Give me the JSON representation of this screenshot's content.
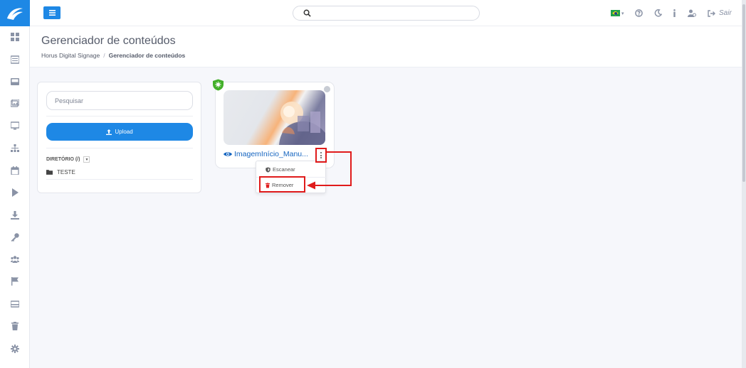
{
  "topbar": {
    "search_placeholder": "",
    "logout_label": "Sair",
    "language_flag": "brazil-flag"
  },
  "header": {
    "title": "Gerenciador de conteúdos",
    "breadcrumb": [
      "Horus Digital Signage",
      "Gerenciador de conteúdos"
    ]
  },
  "left_panel": {
    "search_placeholder": "Pesquisar",
    "upload_label": "Upload",
    "directory_label": "DIRETÓRIO (/)",
    "folders": [
      "TESTE"
    ]
  },
  "content": {
    "items": [
      {
        "title": "ImagemInício_Manu...",
        "status_color": "#c8ccd4"
      }
    ]
  },
  "context_menu": {
    "items": [
      "Escanear",
      "Remover"
    ]
  },
  "colors": {
    "primary": "#1e88e5",
    "annotation": "#e01b1b",
    "shield": "#43b02a"
  },
  "sidebar": {
    "icons": [
      "dashboard-icon",
      "list-icon",
      "media-icon",
      "gallery-icon",
      "monitor-icon",
      "hierarchy-icon",
      "calendar-icon",
      "play-icon",
      "download-icon",
      "key-icon",
      "users-icon",
      "flag-icon",
      "card-icon",
      "trash-icon",
      "gear-icon"
    ]
  }
}
